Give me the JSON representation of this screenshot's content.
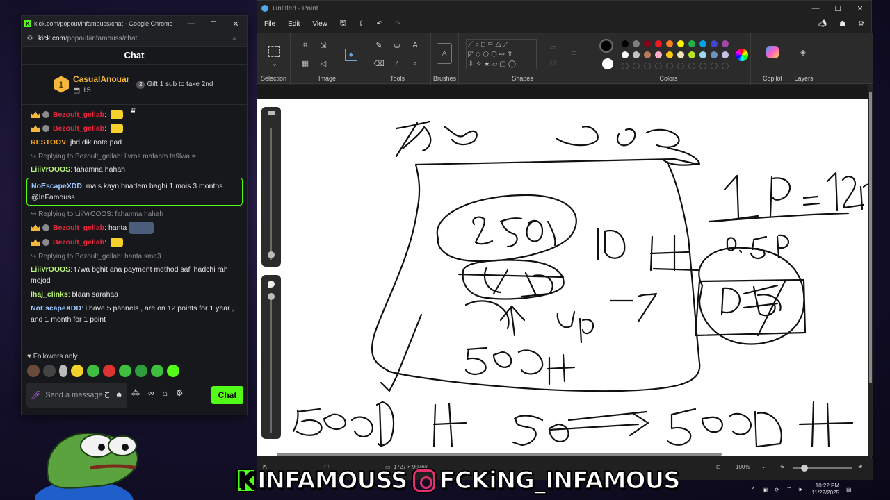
{
  "chrome": {
    "title": "kick.com/popout/infamouss/chat - Google Chrome",
    "url_host": "kick.com",
    "url_path": "/popout/infamouss/chat"
  },
  "chat": {
    "header": "Chat",
    "top_gifter": {
      "rank": "1",
      "name": "CasualAnouar",
      "count": "15"
    },
    "gift_prompt": {
      "rank": "2",
      "text": "Gift 1 sub to take 2nd"
    },
    "messages": [
      {
        "type": "msg",
        "badges": true,
        "user": "Bezoult_gellab",
        "color": "#e8263e",
        "text": "",
        "emote": "yellow"
      },
      {
        "type": "msg",
        "badges": true,
        "user": "Bezoult_gellab",
        "color": "#e8263e",
        "text": "",
        "emote": "yellow"
      },
      {
        "type": "msg",
        "badges": false,
        "user": "RESTOOV",
        "color": "#f5a623",
        "text": "jbd dik note pad"
      },
      {
        "type": "reply",
        "text": "Replying to Bezoult_gellab: livros mafahm ta9lwa ="
      },
      {
        "type": "msg",
        "badges": false,
        "user": "LiiiVrOOOS",
        "color": "#b8f27a",
        "text": "fahamna hahah"
      },
      {
        "type": "msg",
        "badges": false,
        "highlight": true,
        "user": "NoEscapeXDD",
        "color": "#9cc7ff",
        "text": "mais kayn bnadem baghi 1 mois 3 months @InFamouss"
      },
      {
        "type": "reply",
        "text": "Replying to LiiiVrOOOS: fahamna hahah"
      },
      {
        "type": "msg",
        "badges": true,
        "user": "Bezoult_gellab",
        "color": "#e8263e",
        "text": "hanta",
        "emote": "wide"
      },
      {
        "type": "msg",
        "badges": true,
        "user": "Bezoult_gellab",
        "color": "#e8263e",
        "text": "",
        "emote": "yellow"
      },
      {
        "type": "reply",
        "text": "Replying to Bezoult_gellab: hanta sma3"
      },
      {
        "type": "msg",
        "badges": false,
        "user": "LiiiVrOOOS",
        "color": "#b8f27a",
        "text": "t7wa bghit ana payment method safi hadchi rah mojod"
      },
      {
        "type": "msg",
        "badges": false,
        "user": "lhaj_clinks",
        "color": "#b8f27a",
        "text": "blaan sarahaa"
      },
      {
        "type": "msg",
        "badges": false,
        "user": "NoEscapeXDD",
        "color": "#9cc7ff",
        "text": "i have 5 pannels , are on 12 points for 1 year , and 1 month for 1 point"
      }
    ],
    "followers_only": "Followers only",
    "input_placeholder": "Send a message",
    "send_label": "Chat"
  },
  "paint": {
    "title": "Untitled - Paint",
    "menu": [
      "File",
      "Edit",
      "View"
    ],
    "groups": [
      "Selection",
      "Image",
      "Tools",
      "Brushes",
      "Shapes",
      "Colors",
      "Copilot",
      "Layers"
    ],
    "colors": {
      "row1": [
        "#000000",
        "#7f7f7f",
        "#880015",
        "#ed1c24",
        "#ff7f27",
        "#fff200",
        "#22b14c",
        "#00a2e8",
        "#3f48cc",
        "#a349a4"
      ],
      "row2": [
        "#ffffff",
        "#c3c3c3",
        "#b97a57",
        "#ffaec9",
        "#ffc90e",
        "#efe4b0",
        "#b5e61d",
        "#99d9ea",
        "#7092be",
        "#c8bfe7"
      ]
    },
    "primary_color": "#000000",
    "secondary_color": "#ffffff",
    "status": {
      "dimensions": "1727 × 907px",
      "zoom": "100%"
    }
  },
  "overlay": {
    "kick_letter": "K",
    "kick_handle": "INFAMOUSS",
    "ig_handle": "FCKiNG_INFAMOUS"
  },
  "taskbar": {
    "time": "10:22 PM",
    "date": "11/22/2025"
  }
}
